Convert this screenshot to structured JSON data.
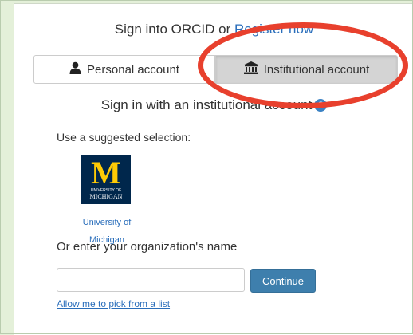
{
  "header": {
    "prefix": "Sign into ORCID or",
    "register_link": "Register now"
  },
  "tabs": [
    {
      "label": "Personal account",
      "icon": "person-icon",
      "selected": false
    },
    {
      "label": "Institutional account",
      "icon": "institution-icon",
      "selected": true
    }
  ],
  "subheading": {
    "text": "Sign in with an institutional account",
    "help_icon": "question-circle-icon",
    "help_glyph": "?"
  },
  "suggested": {
    "label": "Use a suggested selection:",
    "logo": {
      "letter": "M",
      "line1": "UNIVERSITY OF",
      "line2": "MICHIGAN"
    },
    "name_line1": "University of",
    "name_line2": "Michigan"
  },
  "org_search": {
    "label": "Or enter your organization's name",
    "value": "",
    "continue_label": "Continue",
    "pick_link": "Allow me to pick from a list"
  },
  "colors": {
    "background": "#e4f0d9",
    "link": "#2a6ebb",
    "button": "#3e7fad",
    "annotation": "#e8402d",
    "logo_blue": "#00274c",
    "logo_maize": "#ffcb05"
  }
}
